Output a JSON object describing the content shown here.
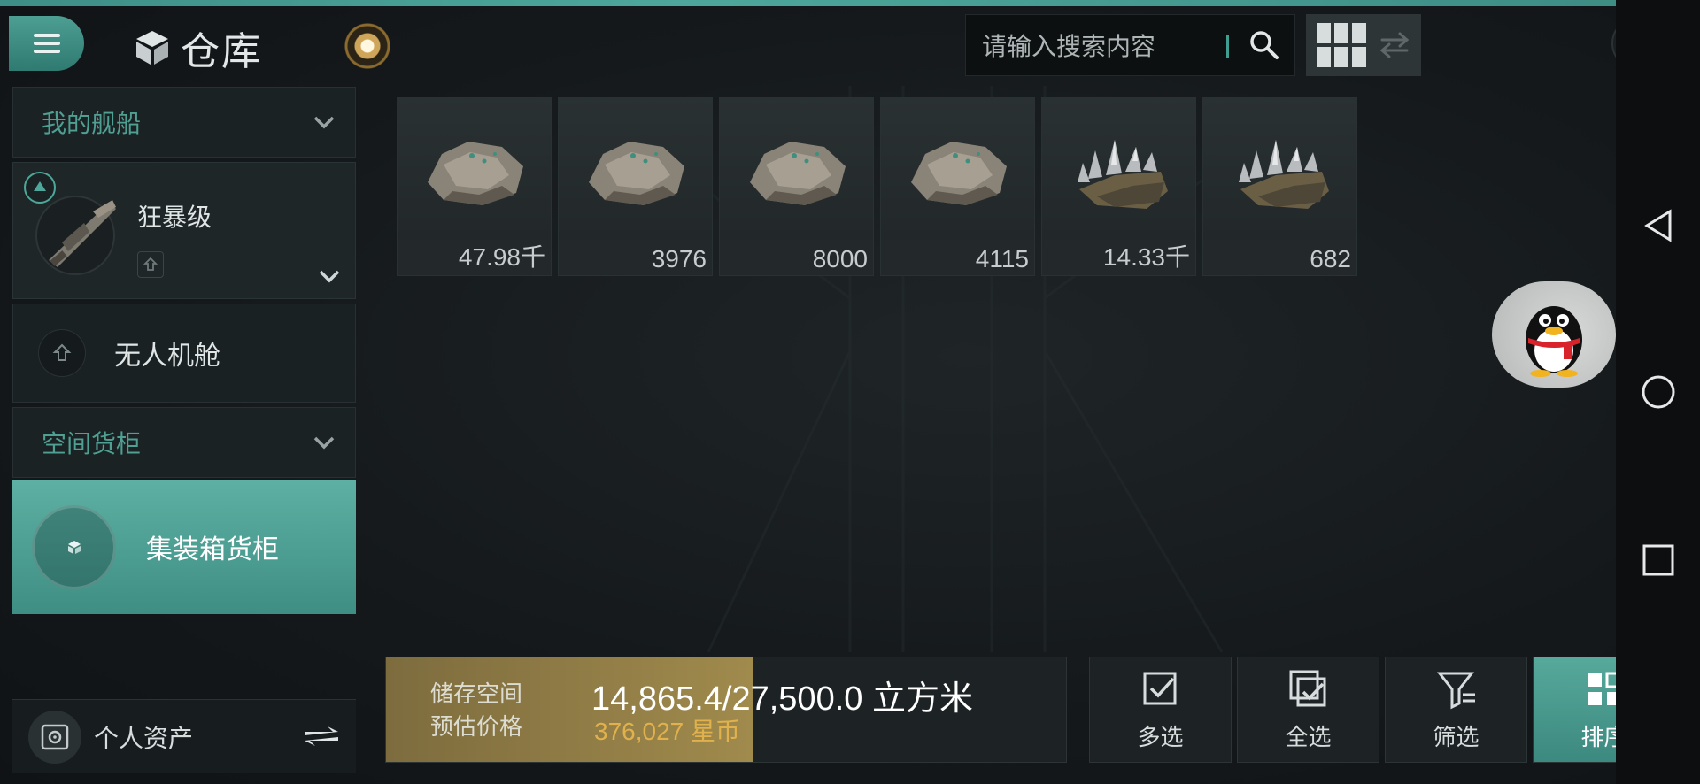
{
  "header": {
    "title": "仓库",
    "search_placeholder": "请输入搜索内容"
  },
  "sidebar": {
    "my_ships": "我的舰船",
    "ship_name": "狂暴级",
    "drone_bay": "无人机舱",
    "space_cargo": "空间货柜",
    "container_cargo": "集装箱货柜",
    "personal_assets": "个人资产"
  },
  "items": [
    {
      "icon": "ore-icon",
      "qty": "47.98千"
    },
    {
      "icon": "ore-icon",
      "qty": "3976"
    },
    {
      "icon": "ore-icon",
      "qty": "8000"
    },
    {
      "icon": "ore-icon",
      "qty": "4115"
    },
    {
      "icon": "crystal-ore-icon",
      "qty": "14.33千"
    },
    {
      "icon": "crystal-ore-icon",
      "qty": "682"
    }
  ],
  "storage": {
    "space_label": "储存空间",
    "price_label": "预估价格",
    "space_value": "14,865.4/27,500.0 立方米",
    "price_value": "376,027 星币",
    "fill_ratio": 0.54
  },
  "actions": {
    "multi_select": "多选",
    "select_all": "全选",
    "filter": "筛选",
    "sort": "排序"
  },
  "colors": {
    "accent": "#4da79a",
    "storage_fill": "#a08a4c",
    "price": "#e0b14c"
  }
}
